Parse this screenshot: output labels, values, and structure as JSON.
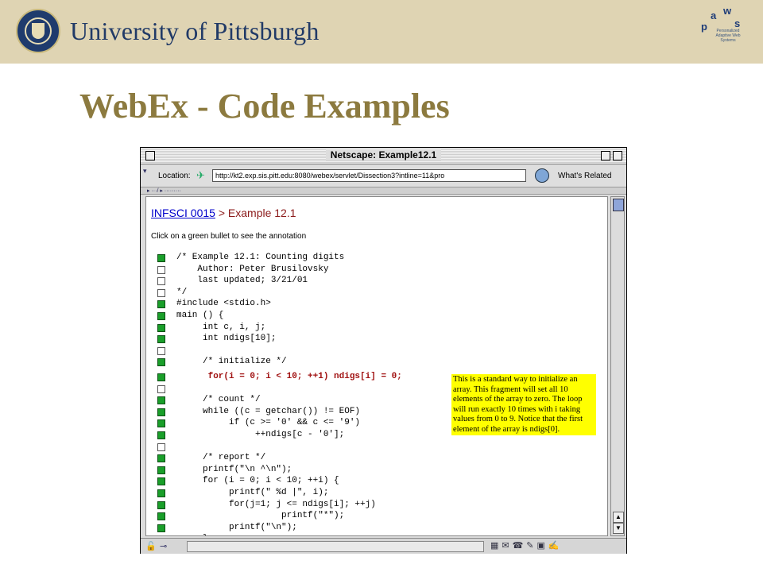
{
  "header": {
    "university": "University of Pittsburgh",
    "paws_letters": [
      "p",
      "a",
      "w",
      "s"
    ],
    "paws_caption": "Personalized Adaptive Web Systems"
  },
  "slide": {
    "title": "WebEx - Code Examples"
  },
  "browser": {
    "window_title": "Netscape: Example12.1",
    "location_label": "Location:",
    "url": "http://kt2.exp.sis.pitt.edu:8080/webex/servlet/Dissection3?intline=11&pro",
    "whats_related": "What's Related",
    "tabstrip": "▸ ···/ ▸ ·········"
  },
  "page": {
    "crumb_link": "INFSCI 0015",
    "crumb_sep": ">",
    "crumb_current": "Example 12.1",
    "instruction": "Click on a green bullet to see the annotation",
    "annotation": "This is a standard way to initialize an array. This fragment will set all 10 elements of the array to zero. The loop will run exactly 10 times with i taking values from 0 to 9. Notice that the first element of the array is ndigs[0].",
    "code_lines": [
      {
        "text": "/* Example 12.1: Counting digits",
        "bullet": "green"
      },
      {
        "text": "    Author: Peter Brusilovsky",
        "bullet": "white"
      },
      {
        "text": "    last updated; 3/21/01",
        "bullet": "white"
      },
      {
        "text": "*/",
        "bullet": "white"
      },
      {
        "text": "#include <stdio.h>",
        "bullet": "green"
      },
      {
        "text": "main () {",
        "bullet": "green"
      },
      {
        "text": "     int c, i, j;",
        "bullet": "green"
      },
      {
        "text": "     int ndigs[10];",
        "bullet": "green"
      },
      {
        "text": "",
        "bullet": "white"
      },
      {
        "text": "     /* initialize */",
        "bullet": "green"
      },
      {
        "text": "      for(i = 0; i < 10; ++1) ndigs[i] = 0;",
        "bullet": "green",
        "highlight": true
      },
      {
        "text": "",
        "bullet": "white"
      },
      {
        "text": "     /* count */",
        "bullet": "green"
      },
      {
        "text": "     while ((c = getchar()) != EOF)",
        "bullet": "green"
      },
      {
        "text": "          if (c >= '0' && c <= '9')",
        "bullet": "green"
      },
      {
        "text": "               ++ndigs[c - '0'];",
        "bullet": "green"
      },
      {
        "text": "",
        "bullet": "white"
      },
      {
        "text": "     /* report */",
        "bullet": "green"
      },
      {
        "text": "     printf(\"\\n ^\\n\");",
        "bullet": "green"
      },
      {
        "text": "     for (i = 0; i < 10; ++i) {",
        "bullet": "green"
      },
      {
        "text": "          printf(\" %d |\", i);",
        "bullet": "green"
      },
      {
        "text": "          for(j=1; j <= ndigs[i]; ++j)",
        "bullet": "green"
      },
      {
        "text": "                    printf(\"*\");",
        "bullet": "green"
      },
      {
        "text": "          printf(\"\\n\");",
        "bullet": "green"
      },
      {
        "text": "     }",
        "bullet": "white"
      }
    ]
  }
}
